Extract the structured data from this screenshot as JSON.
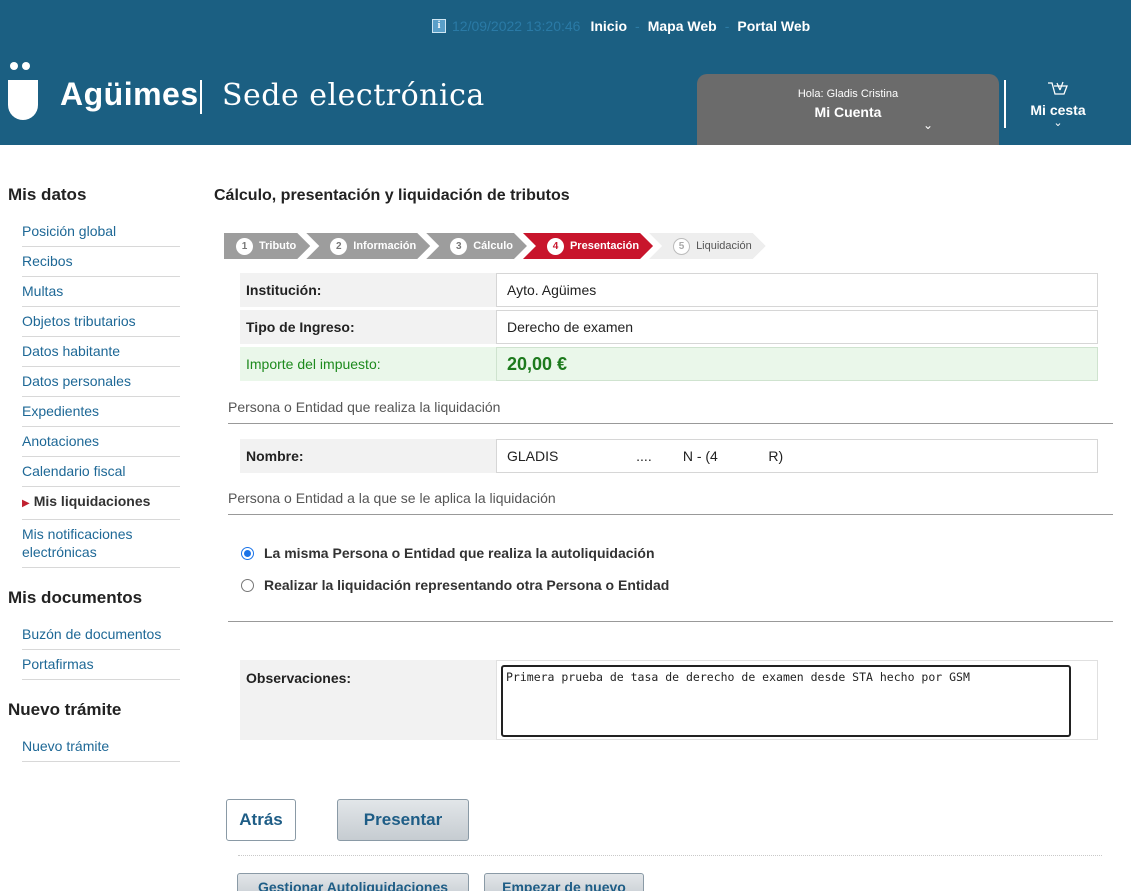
{
  "header": {
    "date": "12/09/2022 13:20:46",
    "nav_links": [
      "Inicio",
      "Mapa Web",
      "Portal Web"
    ],
    "brand_name": "Agüimes",
    "brand_subtitle": "Sede electrónica",
    "greeting": "Hola:  Gladis Cristina",
    "account_label": "Mi Cuenta",
    "cart_label": "Mi cesta",
    "background_color": "#1b5f82"
  },
  "sidebar": {
    "mis_datos_title": "Mis datos",
    "mis_datos_items": [
      "Posición global",
      "Recibos",
      "Multas",
      "Objetos tributarios",
      "Datos habitante",
      "Datos personales",
      "Expedientes",
      "Anotaciones",
      "Calendario fiscal",
      "Mis liquidaciones",
      "Mis notificaciones electrónicas"
    ],
    "active_item": "Mis liquidaciones",
    "mis_documentos_title": "Mis documentos",
    "mis_documentos_items": [
      "Buzón de documentos",
      "Portafirmas"
    ],
    "nuevo_tramite_title": "Nuevo trámite",
    "nuevo_tramite_items": [
      "Nuevo trámite"
    ]
  },
  "main": {
    "title": "Cálculo, presentación y liquidación de tributos",
    "steps": [
      {
        "num": "1",
        "label": "Tributo",
        "state": "done"
      },
      {
        "num": "2",
        "label": "Información",
        "state": "done"
      },
      {
        "num": "3",
        "label": "Cálculo",
        "state": "done"
      },
      {
        "num": "4",
        "label": "Presentación",
        "state": "current"
      },
      {
        "num": "5",
        "label": "Liquidación",
        "state": "todo"
      }
    ],
    "institucion_label": "Institución:",
    "institucion_value": "Ayto. Agüimes",
    "tipo_label": "Tipo de Ingreso:",
    "tipo_value": "Derecho de examen",
    "importe_label": "Importe del impuesto:",
    "importe_value": "20,00 €",
    "section_realiza": "Persona o Entidad que realiza la liquidación",
    "nombre_label": "Nombre:",
    "nombre_value": "GLADIS                    ....        N - (4             R)",
    "section_aplica": "Persona o Entidad a la que se le aplica la liquidación",
    "radio_options": [
      {
        "label": "La misma Persona o Entidad que realiza la autoliquidación",
        "checked": true
      },
      {
        "label": "Realizar la liquidación representando otra Persona o Entidad",
        "checked": false
      }
    ],
    "observaciones_label": "Observaciones:",
    "observaciones_value": "Primera prueba de tasa de derecho de examen desde STA hecho por GSM"
  },
  "buttons": {
    "atras": "Atrás",
    "presentar": "Presentar",
    "gestionar": "Gestionar Autoliquidaciones",
    "empezar": "Empezar de nuevo"
  }
}
